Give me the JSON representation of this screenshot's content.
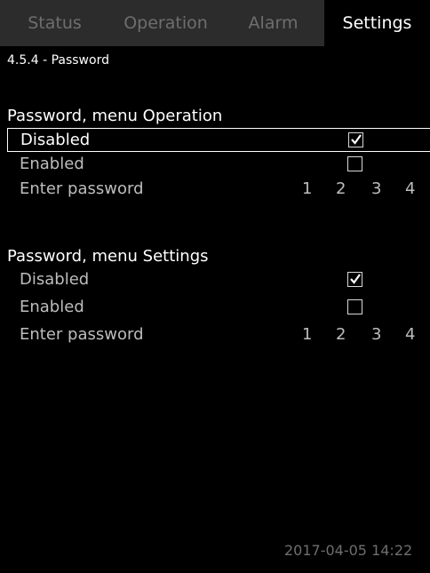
{
  "tabs": [
    {
      "label": "Status"
    },
    {
      "label": "Operation"
    },
    {
      "label": "Alarm"
    },
    {
      "label": "Settings"
    }
  ],
  "breadcrumb": "4.5.4 - Password",
  "sections": [
    {
      "title": "Password, menu Operation",
      "disabled_label": "Disabled",
      "disabled_checked": true,
      "enabled_label": "Enabled",
      "enabled_checked": false,
      "enter_label": "Enter password",
      "digits": [
        "1",
        "2",
        "3",
        "4"
      ]
    },
    {
      "title": "Password, menu Settings",
      "disabled_label": "Disabled",
      "disabled_checked": true,
      "enabled_label": "Enabled",
      "enabled_checked": false,
      "enter_label": "Enter password",
      "digits": [
        "1",
        "2",
        "3",
        "4"
      ]
    }
  ],
  "footer": {
    "datetime": "2017-04-05 14:22"
  },
  "icons": {
    "checked": "checkmark-icon",
    "unchecked": "empty-checkbox-icon"
  }
}
